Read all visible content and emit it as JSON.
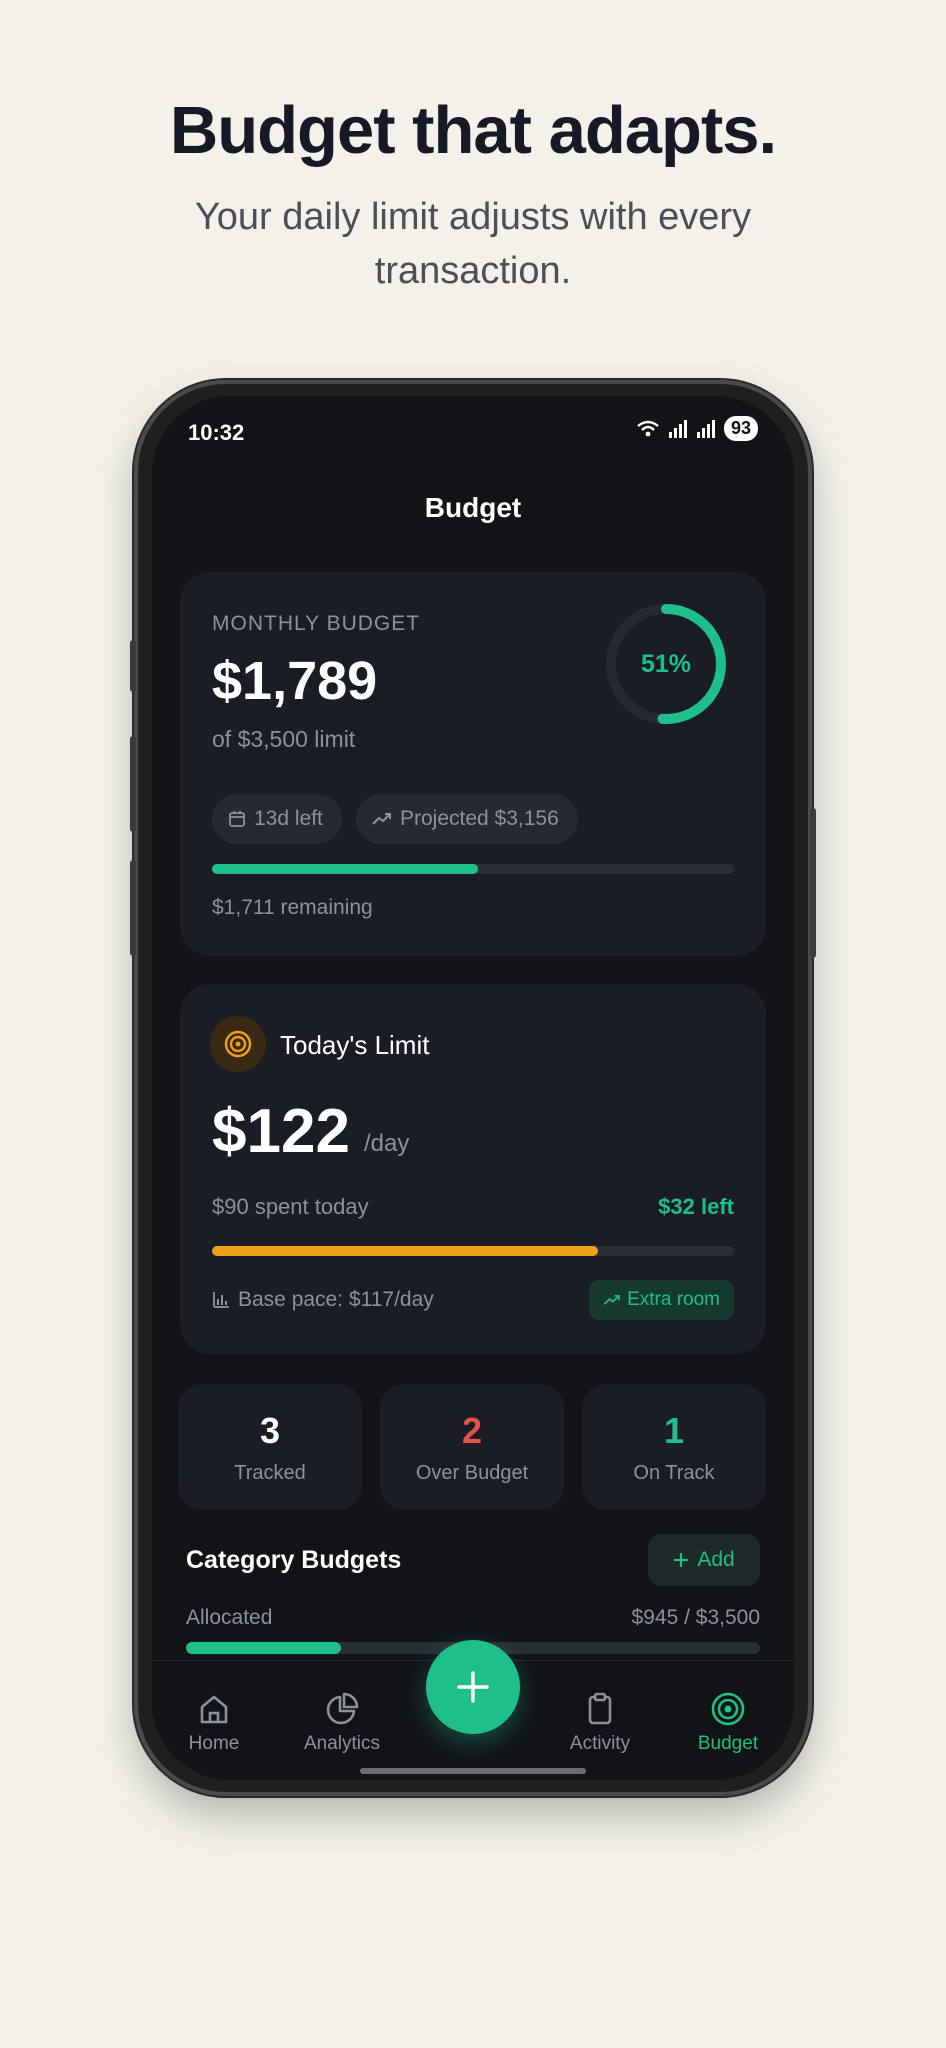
{
  "hero": {
    "headline": "Budget that adapts.",
    "subline": "Your daily limit adjusts with every transaction."
  },
  "status_bar": {
    "time": "10:32",
    "battery": "93",
    "icons": [
      "wifi-icon",
      "signal-icon",
      "signal-icon"
    ]
  },
  "screen": {
    "title": "Budget"
  },
  "monthly_budget": {
    "label": "MONTHLY BUDGET",
    "amount": "$1,789",
    "limit_text": "of $3,500 limit",
    "percent_text": "51%",
    "percent_value": 0.51,
    "days_left": "13d left",
    "projected": "Projected $3,156",
    "remaining": "$1,711 remaining",
    "progress": 0.51
  },
  "todays_limit": {
    "title": "Today's Limit",
    "amount": "$122",
    "unit": "/day",
    "spent": "$90 spent today",
    "left": "$32 left",
    "progress": 0.74,
    "base_pace": "Base pace: $117/day",
    "extra_room": "Extra room"
  },
  "stats": [
    {
      "value": "3",
      "label": "Tracked",
      "color": "#ffffff"
    },
    {
      "value": "2",
      "label": "Over Budget",
      "color": "#e5534b"
    },
    {
      "value": "1",
      "label": "On Track",
      "color": "#1fbf8a"
    }
  ],
  "category_budgets": {
    "title": "Category Budgets",
    "add_label": "Add",
    "allocated_label": "Allocated",
    "allocated_value": "$945 / $3,500",
    "allocated_progress": 0.27
  },
  "nav": [
    {
      "label": "Home",
      "icon": "home-icon"
    },
    {
      "label": "Analytics",
      "icon": "pie-chart-icon"
    },
    {
      "label": "Activity",
      "icon": "clipboard-icon"
    },
    {
      "label": "Budget",
      "icon": "target-icon",
      "active": true
    }
  ],
  "colors": {
    "accent": "#1fbf8a",
    "warning": "#f0a11a",
    "danger": "#e5534b",
    "background": "#111317",
    "card": "#1a1d23"
  }
}
